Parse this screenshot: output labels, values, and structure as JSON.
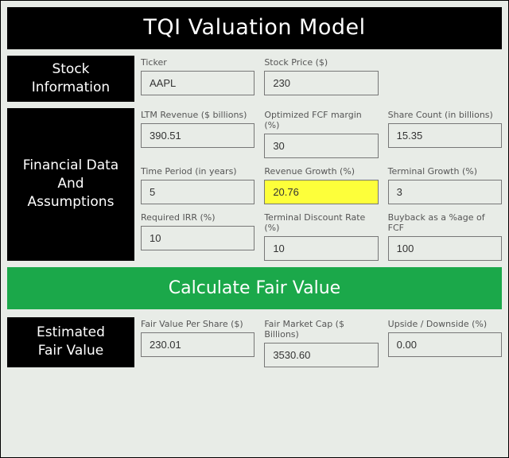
{
  "title": "TQI Valuation Model",
  "sections": {
    "stock_info": {
      "heading": "Stock\nInformation"
    },
    "fin_data": {
      "heading": "Financial Data\nAnd\nAssumptions"
    },
    "fair_value": {
      "heading": "Estimated\nFair Value"
    }
  },
  "fields": {
    "ticker": {
      "label": "Ticker",
      "value": "AAPL"
    },
    "stock_price": {
      "label": "Stock Price ($)",
      "value": "230"
    },
    "ltm_revenue": {
      "label": "LTM Revenue ($ billions)",
      "value": "390.51"
    },
    "fcf_margin": {
      "label": "Optimized FCF margin (%)",
      "value": "30"
    },
    "share_count": {
      "label": "Share Count (in billions)",
      "value": "15.35"
    },
    "time_period": {
      "label": "Time Period (in years)",
      "value": "5"
    },
    "rev_growth": {
      "label": "Revenue Growth (%)",
      "value": "20.76",
      "highlight": true
    },
    "terminal_growth": {
      "label": "Terminal Growth (%)",
      "value": "3"
    },
    "required_irr": {
      "label": "Required IRR (%)",
      "value": "10"
    },
    "terminal_discount": {
      "label": "Terminal Discount Rate (%)",
      "value": "10"
    },
    "buyback_pct": {
      "label": "Buyback as a %age of FCF",
      "value": "100"
    },
    "fv_per_share": {
      "label": "Fair Value Per Share ($)",
      "value": "230.01"
    },
    "fv_market_cap": {
      "label": "Fair Market Cap ($ Billions)",
      "value": "3530.60"
    },
    "upside": {
      "label": "Upside / Downside (%)",
      "value": "0.00"
    }
  },
  "calc_button": "Calculate Fair Value",
  "colors": {
    "accent": "#1ba84a",
    "highlight": "#fdff3a"
  }
}
